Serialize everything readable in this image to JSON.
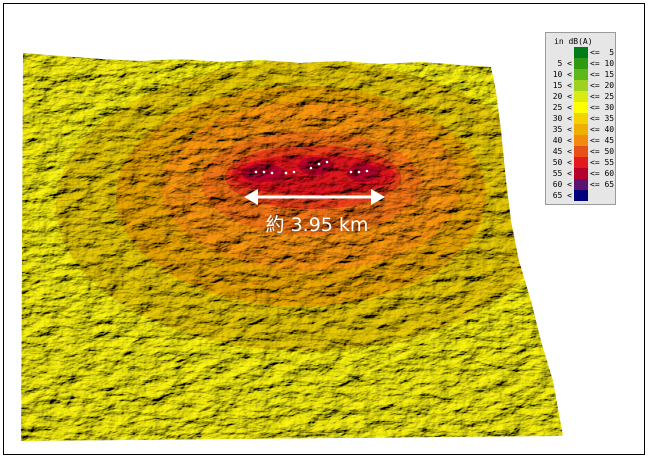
{
  "map": {
    "distance_label": "約 3.95 km"
  },
  "legend": {
    "title": "in dB(A)",
    "items": [
      {
        "low": "",
        "high": "<=  5",
        "color": "#007b1a"
      },
      {
        "low": "5 <",
        "high": "<= 10",
        "color": "#2f9a10"
      },
      {
        "low": "10 <",
        "high": "<= 15",
        "color": "#5db81a"
      },
      {
        "low": "15 <",
        "high": "<= 20",
        "color": "#9fd21e"
      },
      {
        "low": "20 <",
        "high": "<= 25",
        "color": "#d8ea12"
      },
      {
        "low": "25 <",
        "high": "<= 30",
        "color": "#ffff00"
      },
      {
        "low": "30 <",
        "high": "<= 35",
        "color": "#f2d200"
      },
      {
        "low": "35 <",
        "high": "<= 40",
        "color": "#eeb000"
      },
      {
        "low": "40 <",
        "high": "<= 45",
        "color": "#f08a10"
      },
      {
        "low": "45 <",
        "high": "<= 50",
        "color": "#e8501a"
      },
      {
        "low": "50 <",
        "high": "<= 55",
        "color": "#e31a1c"
      },
      {
        "low": "55 <",
        "high": "<= 60",
        "color": "#b4002a"
      },
      {
        "low": "60 <",
        "high": "<= 65",
        "color": "#5a1470"
      },
      {
        "low": "65 <",
        "high": "",
        "color": "#00007a"
      }
    ]
  }
}
